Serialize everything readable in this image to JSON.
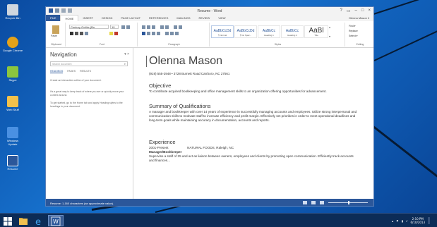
{
  "desktop": {
    "icons": [
      {
        "label": "Recycle Bin",
        "color": "#cfd6de"
      },
      {
        "label": "Google Chrome",
        "color": "#e3a21a"
      },
      {
        "label": "Skype",
        "color": "#8cc63f"
      },
      {
        "label": "Web Stuff",
        "color": "#f3c14b"
      },
      {
        "label": "Windows Update",
        "color": "#4a90e2"
      },
      {
        "label": "Resume",
        "color": "#2b579a"
      }
    ]
  },
  "word": {
    "title": "Resume - Word",
    "window_controls": {
      "help": "?",
      "restore": "▭",
      "minimize": "–",
      "maximize": "□",
      "close": "×"
    },
    "tabs": [
      "FILE",
      "HOME",
      "INSERT",
      "DESIGN",
      "PAGE LAYOUT",
      "REFERENCES",
      "MAILINGS",
      "REVIEW",
      "VIEW"
    ],
    "active_tab": "HOME",
    "user": "Olenna Mason ▾",
    "ribbon": {
      "clipboard_label": "Clipboard",
      "paste_label": "Paste",
      "font_name": "Century Gothic (Bo",
      "font_size": "10",
      "font_label": "Font",
      "paragraph_label": "Paragraph",
      "styles_label": "Styles",
      "editing_label": "Editing",
      "styles": [
        {
          "sample": "AaBbCcDd",
          "name": "¶ Normal"
        },
        {
          "sample": "AaBbCcDd",
          "name": "¶ No Spac..."
        },
        {
          "sample": "AaBbCc",
          "name": "Heading 1"
        },
        {
          "sample": "AaBbCc",
          "name": "Heading 2"
        },
        {
          "sample": "AaBl",
          "name": "Title"
        }
      ],
      "editing": {
        "find": "Find ▾",
        "replace": "Replace",
        "select": "Select ▾"
      }
    },
    "nav": {
      "title": "Navigation",
      "search_placeholder": "Search document",
      "tabs": [
        "HEADINGS",
        "PAGES",
        "RESULTS"
      ],
      "active_tab": "HEADINGS",
      "text1": "Create an interactive outline of your document.",
      "text2": "It's a great way to keep track of where you are or quickly move your content around.",
      "text3": "To get started, go to the Home tab and apply Heading styles to the headings in your document."
    },
    "document": {
      "name": "Olenna Mason",
      "contact": "(919) 555-2948 • 3728 Burnett Road Carrboro, NC 27561",
      "objective_heading": "Objective",
      "objective_text": "To contribute acquired bookkeeping and office management skills to an organization offering opportunities for advancement.",
      "summary_heading": "Summary of Qualifications",
      "summary_text": "A manager and bookkeeper with over 14 years of experience in successfully managing accounts and employees. Utilize strong interpersonal and communication skills to motivate staff to increase efficiency and profit margin. Effectively set priorities in order to meet operational deadlines and long-term goals while maintaining accuracy in documentation, accounts and reports.",
      "experience_heading": "Experience",
      "exp_dates": "2001-Present",
      "exp_company": "NATURAL FOODS, Raleigh, NC",
      "exp_role": "Manager/Bookkeeper",
      "exp_text": "Supervise a staff of 25 and act as liaison between owners, employees and clients by promoting open communication. Efficiently track accounts and finances..."
    },
    "status": {
      "text": "Resume: 1,160 characters (an approximate value)."
    }
  },
  "taskbar": {
    "clock_time": "2:10 PM",
    "clock_date": "6/10/2013"
  },
  "colors": {
    "word_blue": "#2b579a",
    "desktop_blue": "#1670cc"
  }
}
